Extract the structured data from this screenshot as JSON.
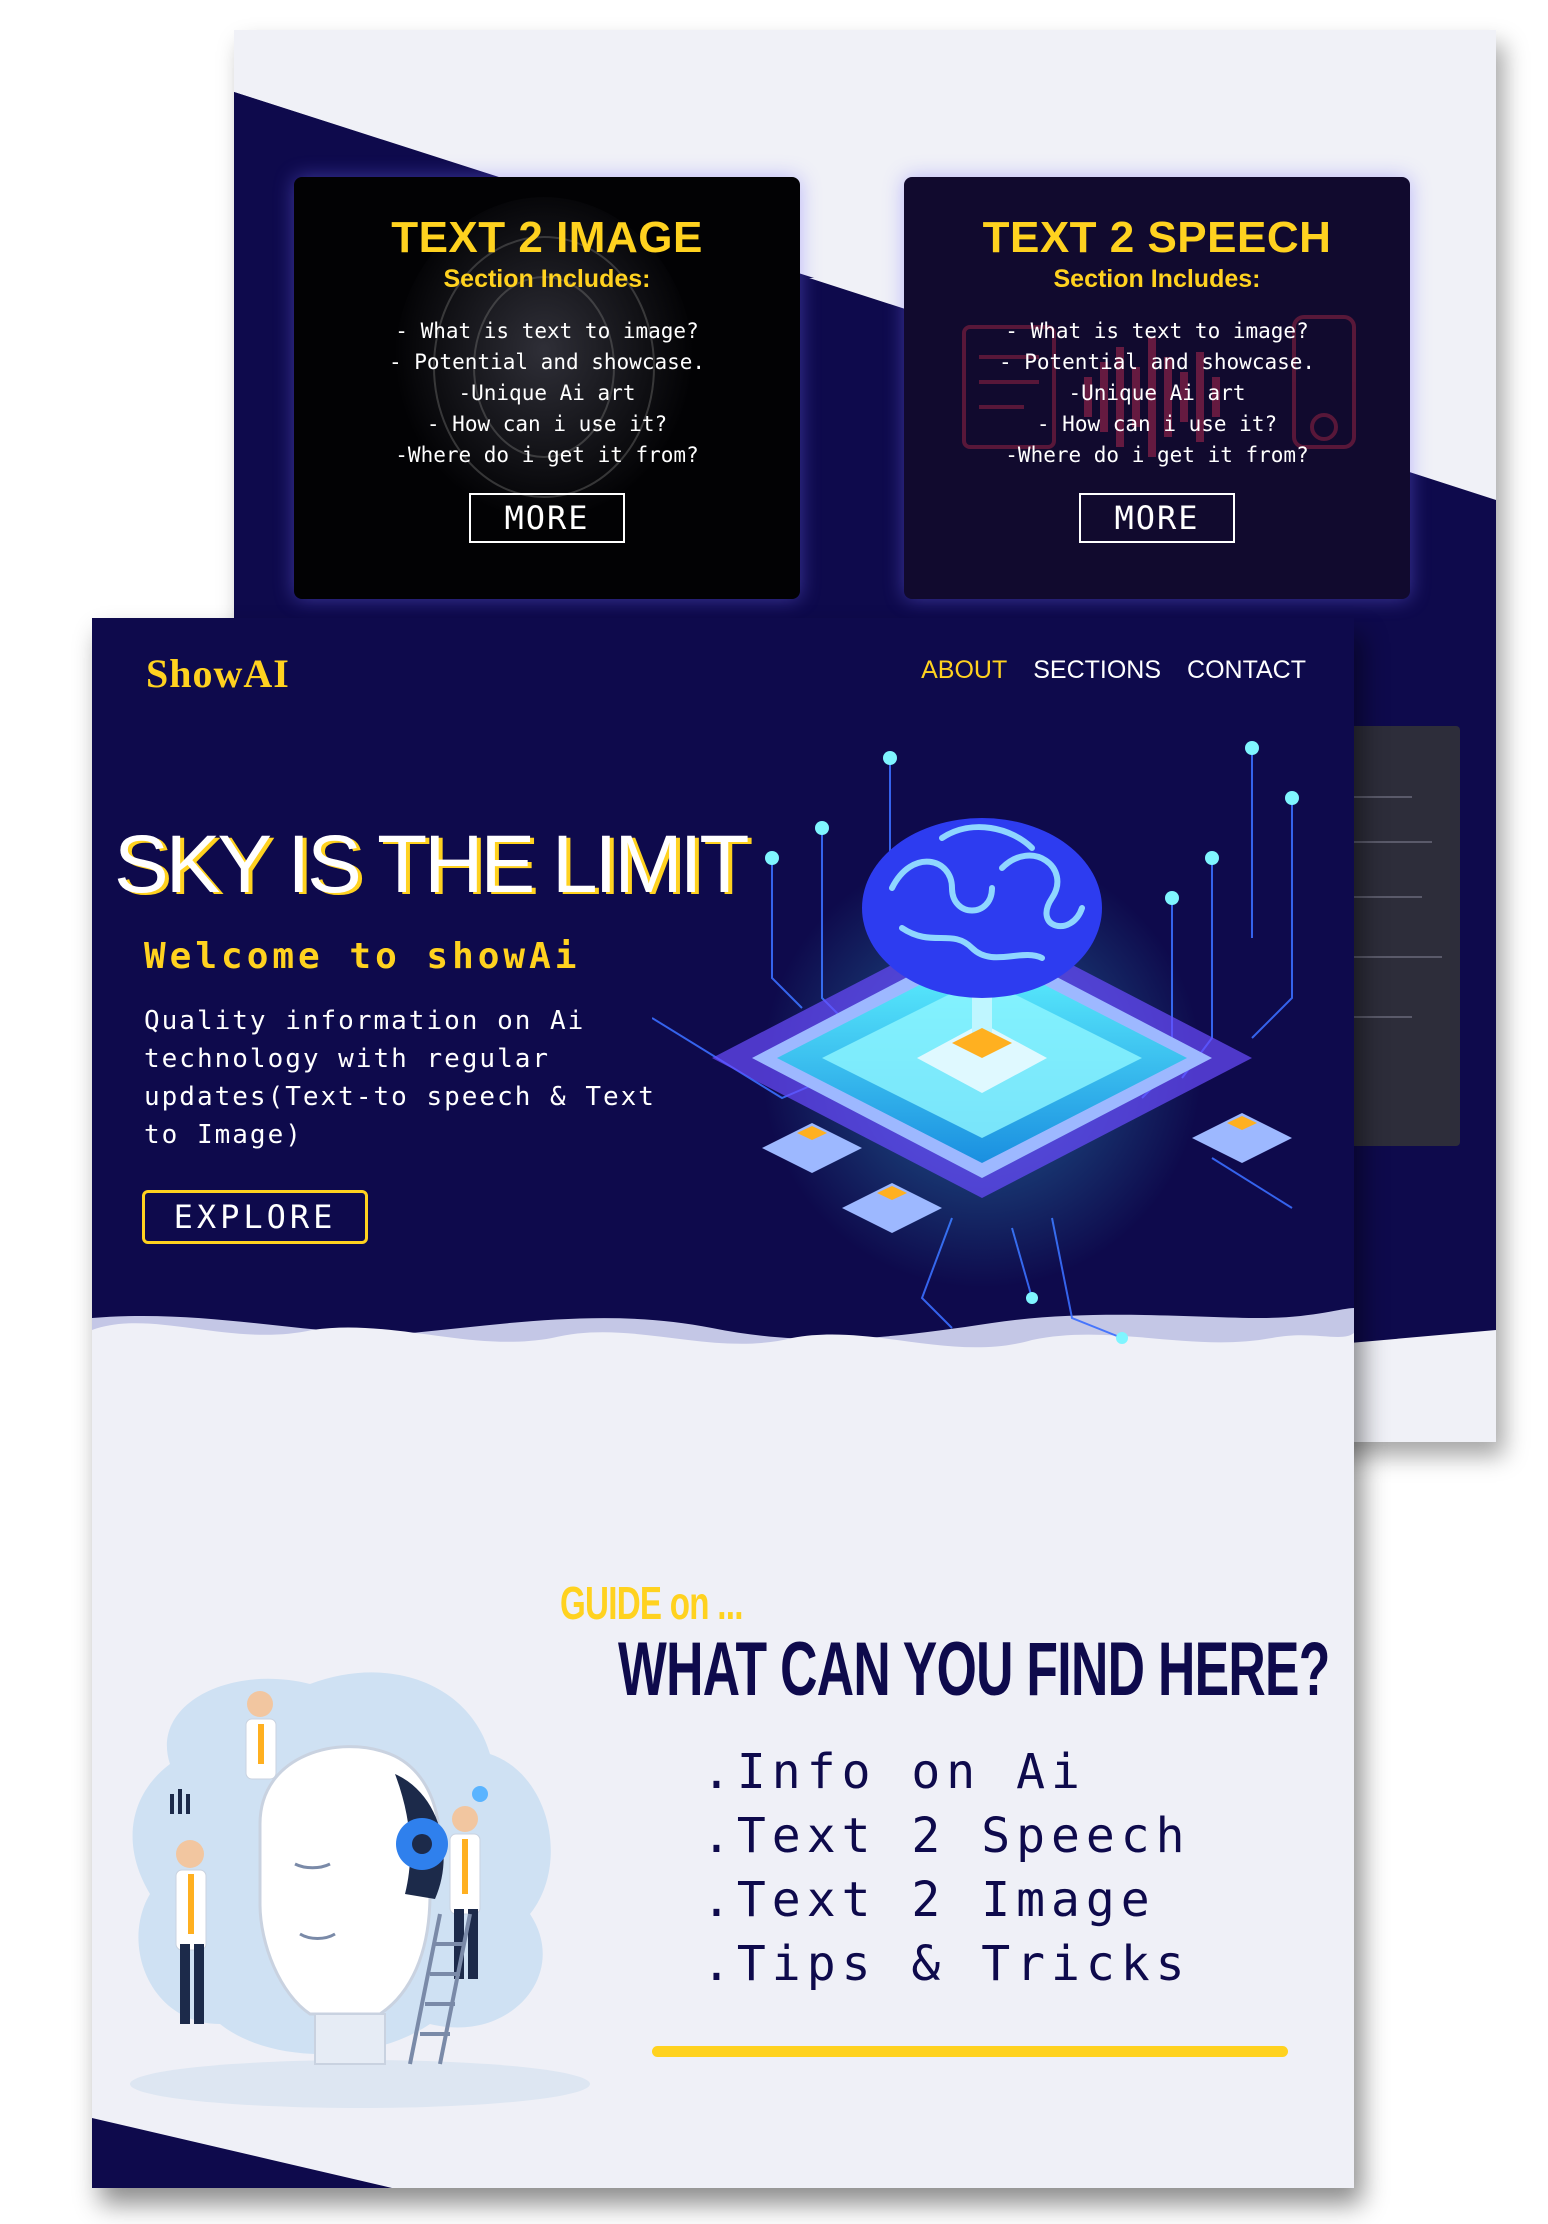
{
  "brand": {
    "name": "ShowAI"
  },
  "colors": {
    "navy": "#0e0a4c",
    "accent": "#ffd21f",
    "light_bg": "#eff0f7"
  },
  "nav": [
    {
      "label": "ABOUT",
      "active": true
    },
    {
      "label": "SECTIONS",
      "active": false
    },
    {
      "label": "CONTACT",
      "active": false
    }
  ],
  "hero": {
    "title": "SKY IS THE LIMIT",
    "welcome": "Welcome to showAi",
    "description": "Quality information on Ai technology with regular updates(Text-to speech & Text to Image)",
    "cta_label": "EXPLORE"
  },
  "cards": [
    {
      "title": "TEXT 2 IMAGE",
      "subtitle": "Section Includes:",
      "items": [
        "- What is text to image?",
        "- Potential and showcase.",
        "-Unique Ai art",
        "- How can i use it?",
        "-Where do i get it from?"
      ],
      "button_label": "MORE"
    },
    {
      "title": "TEXT 2 SPEECH",
      "subtitle": "Section Includes:",
      "items": [
        "- What is text to image?",
        "- Potential and showcase.",
        "-Unique Ai art",
        "- How can i use it?",
        "-Where do i get it from?"
      ],
      "button_label": "MORE"
    }
  ],
  "guide": {
    "kicker": "GUIDE on ...",
    "heading": "WHAT CAN YOU FIND HERE?",
    "items": [
      ".Info on Ai",
      ".Text 2 Speech",
      ".Text 2 Image",
      ".Tips & Tricks"
    ]
  },
  "icons": [
    "circuit-brain-illustration",
    "ai-robot-head-illustration",
    "text-to-speech-icon",
    "text-to-image-icon"
  ]
}
